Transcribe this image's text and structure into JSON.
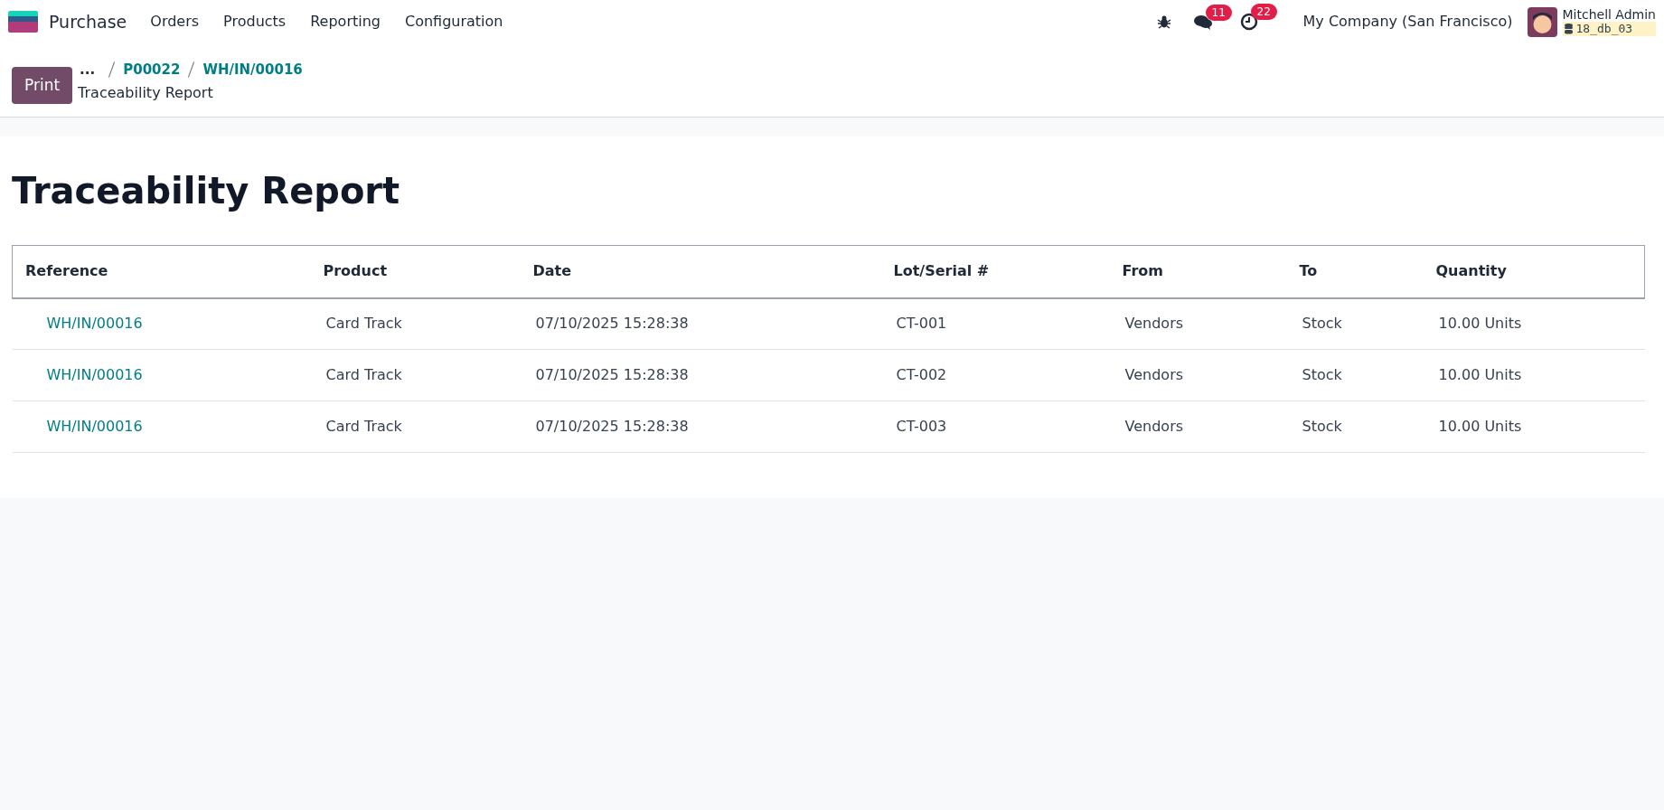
{
  "navbar": {
    "app_name": "Purchase",
    "menu": [
      "Orders",
      "Products",
      "Reporting",
      "Configuration"
    ],
    "messages_count": "11",
    "activities_count": "22",
    "company": "My Company (San Francisco)",
    "user_name": "Mitchell Admin",
    "database": "18_db_03"
  },
  "control_panel": {
    "print_button": "Print",
    "breadcrumb_more": "...",
    "breadcrumbs": [
      "P00022",
      "WH/IN/00016"
    ],
    "current": "Traceability Report"
  },
  "report": {
    "title": "Traceability Report",
    "table": {
      "columns": [
        "Reference",
        "Product",
        "Date",
        "Lot/Serial #",
        "From",
        "To",
        "Quantity"
      ],
      "rows": [
        {
          "reference": "WH/IN/00016",
          "product": "Card Track",
          "date": "07/10/2025 15:28:38",
          "lot": "CT-001",
          "from": "Vendors",
          "to": "Stock",
          "quantity": "10.00 Units"
        },
        {
          "reference": "WH/IN/00016",
          "product": "Card Track",
          "date": "07/10/2025 15:28:38",
          "lot": "CT-002",
          "from": "Vendors",
          "to": "Stock",
          "quantity": "10.00 Units"
        },
        {
          "reference": "WH/IN/00016",
          "product": "Card Track",
          "date": "07/10/2025 15:28:38",
          "lot": "CT-003",
          "from": "Vendors",
          "to": "Stock",
          "quantity": "10.00 Units"
        }
      ]
    }
  }
}
